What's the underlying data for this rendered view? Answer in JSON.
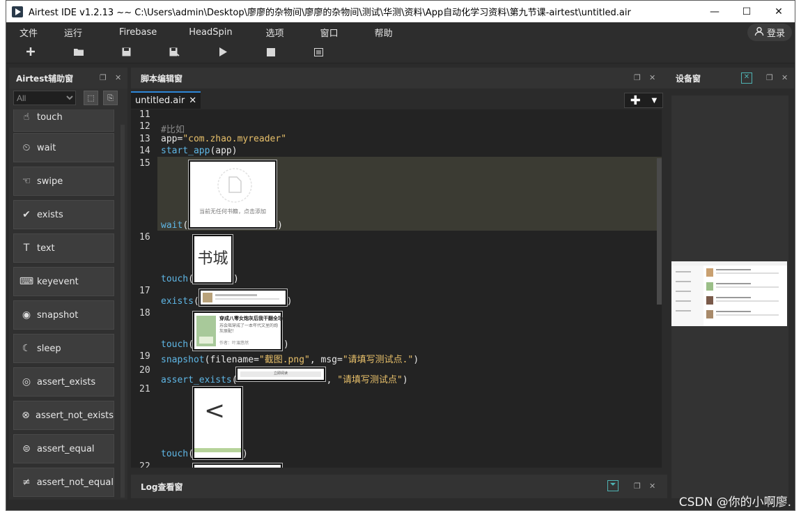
{
  "window": {
    "title": "Airtest IDE v1.2.13 ~~ C:\\Users\\admin\\Desktop\\廖廖的杂物间\\廖廖的杂物间\\测试\\华测\\资料\\App自动化学习资料\\第九节课-airtest\\untitled.air",
    "buttons": [
      "—",
      "☐",
      "✕"
    ]
  },
  "menu": [
    "文件",
    "运行",
    "Firebase",
    "HeadSpin",
    "选项",
    "窗口",
    "帮助"
  ],
  "login_label": "登录",
  "toolbar_icons": [
    "plus-icon",
    "folder-icon",
    "save-icon",
    "save-as-icon",
    "run-icon",
    "stop-icon",
    "log-list-icon"
  ],
  "assist_panel": {
    "title": "Airtest辅助窗",
    "filter_value": "All",
    "items": [
      {
        "label": "touch",
        "icon": "touch-icon"
      },
      {
        "label": "wait",
        "icon": "clock-icon"
      },
      {
        "label": "swipe",
        "icon": "swipe-icon"
      },
      {
        "label": "exists",
        "icon": "check-circle-icon"
      },
      {
        "label": "text",
        "icon": "text-icon"
      },
      {
        "label": "keyevent",
        "icon": "keyboard-icon"
      },
      {
        "label": "snapshot",
        "icon": "camera-icon"
      },
      {
        "label": "sleep",
        "icon": "moon-icon"
      },
      {
        "label": "assert_exists",
        "icon": "target-icon"
      },
      {
        "label": "assert_not_exists",
        "icon": "target-x-icon"
      },
      {
        "label": "assert_equal",
        "icon": "equal-icon"
      },
      {
        "label": "assert_not_equal",
        "icon": "not-equal-icon"
      }
    ]
  },
  "editor": {
    "title": "脚本编辑窗",
    "tab_label": "untitled.air",
    "add_label": "✚",
    "line_numbers": [
      "11",
      "12",
      "13",
      "14",
      "15",
      "16",
      "17",
      "18",
      "19",
      "20",
      "21",
      "22"
    ],
    "lines": {
      "l12": "#比如",
      "l13_a": "app=",
      "l13_b": "\"com.zhao.myreader\"",
      "l14_a": "start_app",
      "l14_b": "(app)",
      "l15_a": "wait",
      "l15_b": "(",
      "l15_c": ")",
      "l16_a": "touch",
      "l16_b": "(",
      "l16_c": ")",
      "l17_a": "exists",
      "l17_b": "(",
      "l17_c": ")",
      "l18_a": "touch",
      "l18_b": "(",
      "l18_c": ")",
      "l19_a": "snapshot",
      "l19_b": "(filename=",
      "l19_c": "\"截图.png\"",
      "l19_d": ", msg=",
      "l19_e": "\"请填写测试点.\"",
      "l19_f": ")",
      "l20_a": "assert_exists",
      "l20_b": "(",
      "l20_c": ", ",
      "l20_d": "\"请填写测试点\"",
      "l20_e": ")",
      "l21_a": "touch",
      "l21_b": "(",
      "l21_c": ")"
    },
    "thumbnails": {
      "empty_shelf_text": "当前无任何书籍，点击添加",
      "bookstore_text": "书城",
      "book_title": "穿成八零女炮灰后我干翻全场",
      "book_desc": "苏会瑶穿成了一本年代文里的炮灰原配！",
      "book_author": "作者：叶湄悠然",
      "assert_button_text": "立即阅读",
      "back_glyph": "<"
    }
  },
  "log_panel": {
    "title": "Log查看窗"
  },
  "device_panel": {
    "title": "设备窗"
  },
  "watermark": "CSDN @你的小啊廖."
}
